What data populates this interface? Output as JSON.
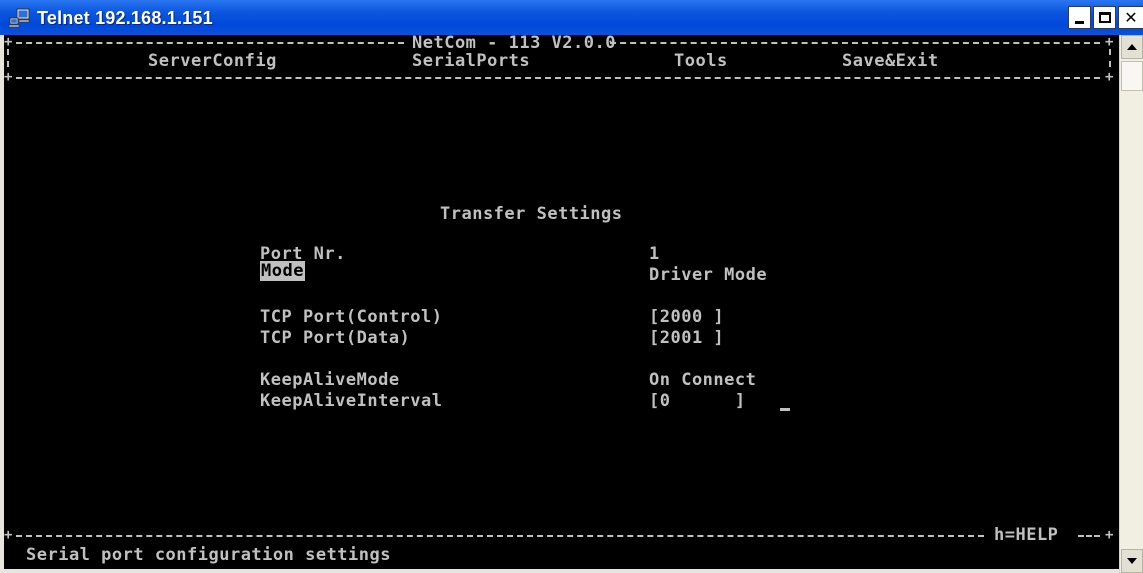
{
  "window": {
    "title": "Telnet 192.168.1.151",
    "icon": "telnet-computer-icon",
    "titlebar_color": "#0b56e0"
  },
  "terminal": {
    "header_title": "NetCom - 113 V2.0.0",
    "menu": [
      "ServerConfig",
      "SerialPorts",
      "Tools",
      "Save&Exit"
    ],
    "section_title": "Transfer Settings",
    "fields": {
      "port_nr": {
        "label": "Port Nr.",
        "value": "1"
      },
      "mode": {
        "label": "Mode",
        "value": "Driver Mode"
      },
      "tcp_control": {
        "label": "TCP Port(Control)",
        "value": "[2000 ]"
      },
      "tcp_data": {
        "label": "TCP Port(Data)",
        "value": "[2001 ]"
      },
      "keepalive_mode": {
        "label": "KeepAliveMode",
        "value": "On Connect"
      },
      "keepalive_interval": {
        "label": "KeepAliveInterval",
        "value": "[0      ]"
      }
    },
    "help_hint": "h=HELP",
    "status_text": "Serial port configuration settings",
    "fg_color": "#c0c0c0",
    "bg_color": "#000000"
  }
}
